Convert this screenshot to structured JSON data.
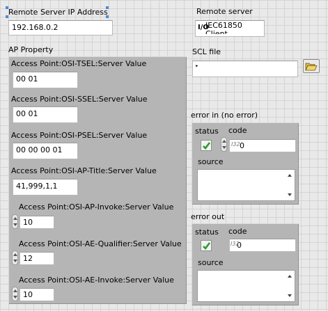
{
  "remote_ip": {
    "label": "Remote Server IP Address",
    "value": "192.168.0.2"
  },
  "remote_server": {
    "label": "Remote server",
    "value_line1": "IEC61850",
    "value_line2": "Client"
  },
  "ap_property": {
    "label": "AP Property",
    "fields": [
      {
        "label": "Access Point:OSI-TSEL:Server Value",
        "value": "00 01"
      },
      {
        "label": "Access Point:OSI-SSEL:Server Value",
        "value": "00 01"
      },
      {
        "label": "Access Point:OSI-PSEL:Server Value",
        "value": "00 00 00 01"
      },
      {
        "label": "Access Point:OSI-AP-Title:Server Value",
        "value": "41,999,1,1"
      },
      {
        "label": "Access Point:OSI-AP-Invoke:Server Value",
        "value": "10"
      },
      {
        "label": "Access Point:OSI-AE-Qualifier:Server Value",
        "value": "12"
      },
      {
        "label": "Access Point:OSI-AE-Invoke:Server Value",
        "value": "10"
      }
    ]
  },
  "scl_file": {
    "label": "SCL file",
    "value": ""
  },
  "error_in": {
    "label": "error in (no error)",
    "status_label": "status",
    "code_label": "code",
    "code_value": "0",
    "source_label": "source",
    "source_value": ""
  },
  "error_out": {
    "label": "error out",
    "status_label": "status",
    "code_label": "code",
    "code_value": "0",
    "source_label": "source",
    "source_value": ""
  },
  "colors": {
    "panel": "#b5b5b5",
    "background": "#e9e9e9",
    "check_green": "#2e9a2e"
  }
}
